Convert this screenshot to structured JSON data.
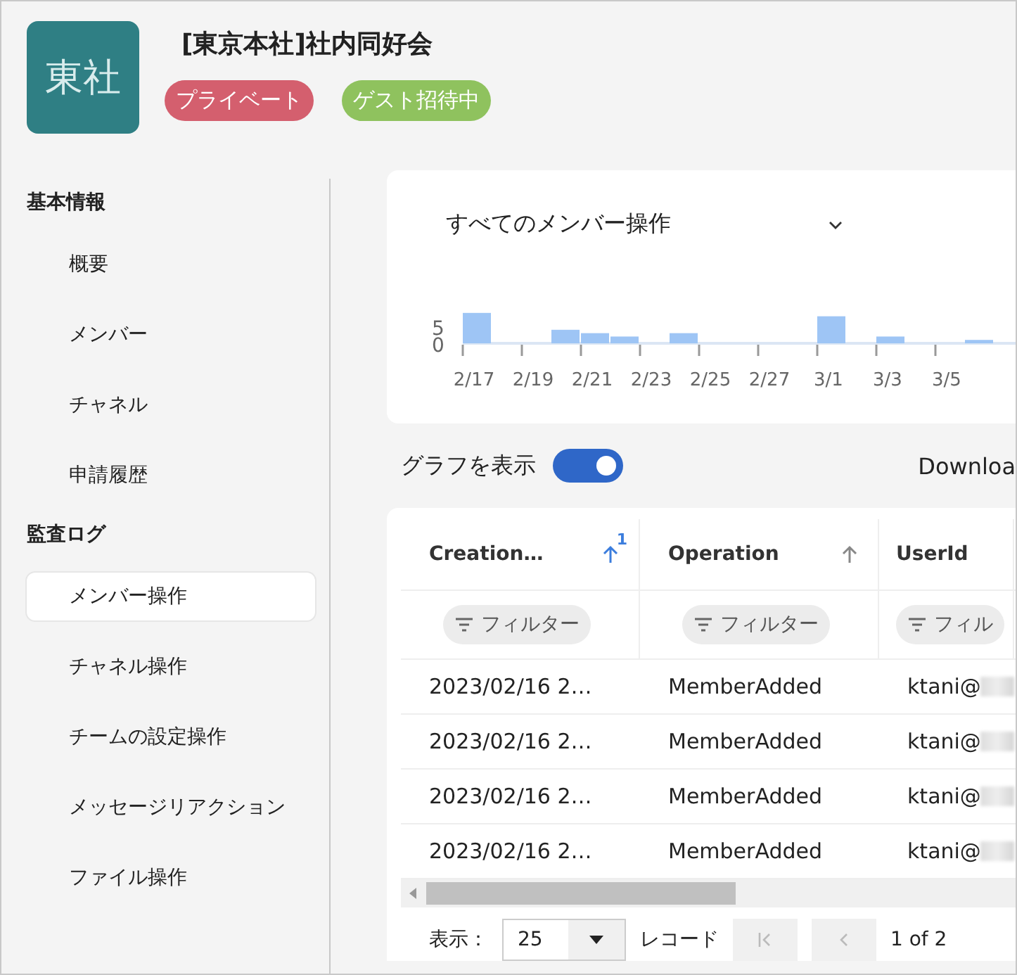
{
  "header": {
    "avatar_text": "東社",
    "title": "[東京本社]社内同好会",
    "badges": [
      {
        "label": "プライベート",
        "color": "#d45f6e"
      },
      {
        "label": "ゲスト招待中",
        "color": "#8fc25e"
      }
    ]
  },
  "sidebar": {
    "sections": [
      {
        "heading": "基本情報",
        "items": [
          {
            "label": "概要",
            "selected": false
          },
          {
            "label": "メンバー",
            "selected": false
          },
          {
            "label": "チャネル",
            "selected": false
          },
          {
            "label": "申請履歴",
            "selected": false
          }
        ]
      },
      {
        "heading": "監査ログ",
        "items": [
          {
            "label": "メンバー操作",
            "selected": true
          },
          {
            "label": "チャネル操作",
            "selected": false
          },
          {
            "label": "チームの設定操作",
            "selected": false
          },
          {
            "label": "メッセージリアクション",
            "selected": false
          },
          {
            "label": "ファイル操作",
            "selected": false
          }
        ]
      }
    ]
  },
  "chart_card": {
    "dropdown": "すべてのメンバー操作",
    "chart_data": {
      "type": "bar",
      "categories": [
        "2/17",
        null,
        "2/19",
        null,
        "2/21",
        null,
        "2/23",
        null,
        "2/25",
        null,
        "2/27",
        null,
        "3/1",
        null,
        "3/3",
        null,
        "3/5",
        null
      ],
      "values": [
        9,
        0,
        0,
        4,
        3,
        2,
        0,
        3,
        0,
        0,
        0,
        0,
        8,
        0,
        2,
        0,
        0,
        1
      ],
      "ylim": [
        0,
        10
      ],
      "yticks": [
        0,
        5
      ]
    }
  },
  "toolbar": {
    "toggle_label": "グラフを表示",
    "toggle_on": true,
    "download": "Downloa"
  },
  "table": {
    "columns": [
      {
        "label": "Creation…",
        "kind": "text",
        "sortable": true,
        "sorted": true,
        "sort_order": "1",
        "filter": "フィルター"
      },
      {
        "label": "Operation",
        "kind": "text",
        "sortable": true,
        "sorted": false,
        "filter": "フィルター"
      },
      {
        "label": "UserId",
        "kind": "masked",
        "sortable": false,
        "sorted": false,
        "filter": "フィル"
      }
    ],
    "rows": [
      [
        "2023/02/16 2…",
        "MemberAdded",
        "ktani@"
      ],
      [
        "2023/02/16 2…",
        "MemberAdded",
        "ktani@"
      ],
      [
        "2023/02/16 2…",
        "MemberAdded",
        "ktani@"
      ],
      [
        "2023/02/16 2…",
        "MemberAdded",
        "ktani@"
      ]
    ]
  },
  "pagination": {
    "show_label": "表示：",
    "page_size": "25",
    "records_label": "レコード",
    "page_info": "1 of 2"
  }
}
